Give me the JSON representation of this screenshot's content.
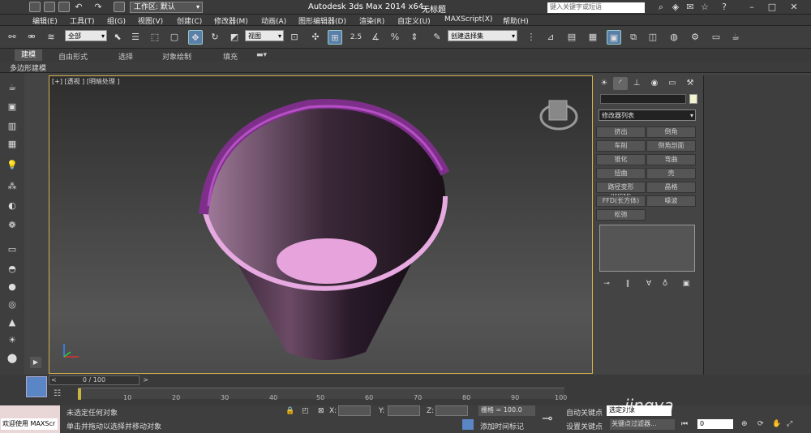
{
  "titlebar": {
    "workspace": "工作区: 默认",
    "app_title": "Autodesk 3ds Max  2014 x64",
    "doc_title": "无标题",
    "search_placeholder": "键入关键字或短语"
  },
  "menubar": [
    "编辑(E)",
    "工具(T)",
    "组(G)",
    "视图(V)",
    "创建(C)",
    "修改器(M)",
    "动画(A)",
    "图形编辑器(D)",
    "渲染(R)",
    "自定义(U)",
    "MAXScript(X)",
    "帮助(H)"
  ],
  "toolbar": {
    "filter": "全部",
    "refcoord": "视图",
    "snap_angle": "2.5",
    "percent": "%",
    "named_selection": "创建选择集"
  },
  "ribbon": {
    "tabs": [
      "建模",
      "自由形式",
      "选择",
      "对象绘制",
      "填充"
    ],
    "active_label": "多边形建模"
  },
  "viewport": {
    "label": "[+] [透视 ] [明暗处理 ]"
  },
  "command_panel": {
    "modifier_list": "修改器列表",
    "modifiers": [
      "挤出",
      "倒角",
      "车削",
      "倒角剖面",
      "锥化",
      "弯曲",
      "扭曲",
      "壳",
      "路径变形 (WSM)",
      "晶格",
      "FFD(长方体)",
      "噪波",
      "松弛"
    ]
  },
  "timeline": {
    "position": "0 / 100",
    "ticks": [
      "10",
      "20",
      "30",
      "40",
      "50",
      "60",
      "70",
      "80",
      "90",
      "100"
    ]
  },
  "status": {
    "maxscript": "欢迎使用 MAXScr",
    "line1": "未选定任何对象",
    "line2": "单击并拖动以选择并移动对象",
    "x_label": "X:",
    "y_label": "Y:",
    "z_label": "Z:",
    "grid": "栅格 = 100.0",
    "add_time_tag": "添加时间标记",
    "auto_key": "自动关键点",
    "selected": "选定对象",
    "set_key": "设置关键点",
    "key_filters": "关键点过滤器...",
    "frame": "0"
  },
  "watermark": "jingya"
}
